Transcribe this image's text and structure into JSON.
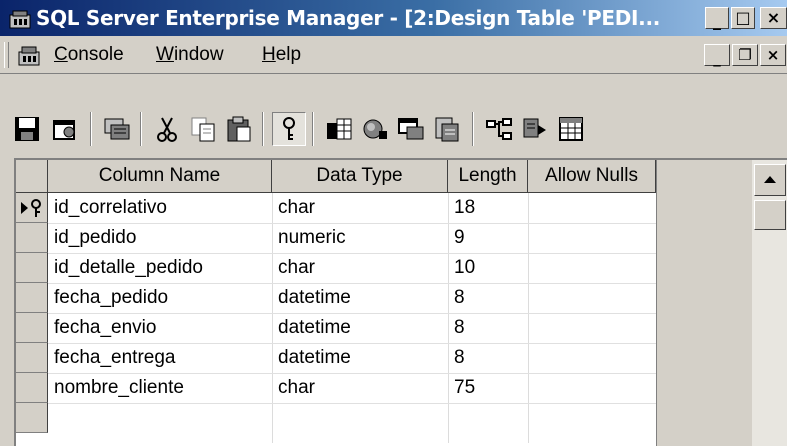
{
  "window": {
    "title": "SQL Server Enterprise Manager - [2:Design Table 'PEDI...",
    "minimize_label": "_",
    "maximize_label": "□",
    "close_label": "×"
  },
  "menu": {
    "items": [
      "Console",
      "Window",
      "Help"
    ],
    "mdi_minimize": "_",
    "mdi_restore": "❐",
    "mdi_close": "×"
  },
  "toolbar": {
    "buttons": [
      {
        "icon": "save-icon"
      },
      {
        "icon": "properties-icon"
      },
      {
        "icon": "generate-script-icon"
      },
      {
        "icon": "cut-icon"
      },
      {
        "icon": "copy-icon"
      },
      {
        "icon": "paste-icon"
      },
      {
        "icon": "primary-key-icon",
        "pressed": true
      },
      {
        "icon": "table-properties-icon"
      },
      {
        "icon": "manage-indexes-icon"
      },
      {
        "icon": "manage-relationships-icon"
      },
      {
        "icon": "manage-constraints-icon"
      },
      {
        "icon": "manage-triggers-icon"
      },
      {
        "icon": "insert-column-icon"
      },
      {
        "icon": "grid-view-icon"
      }
    ]
  },
  "grid": {
    "headers": [
      "Column Name",
      "Data Type",
      "Length",
      "Allow Nulls"
    ],
    "rows": [
      {
        "name": "id_correlativo",
        "type": "char",
        "length": "18",
        "primary_key": true
      },
      {
        "name": "id_pedido",
        "type": "numeric",
        "length": "9"
      },
      {
        "name": "id_detalle_pedido",
        "type": "char",
        "length": "10"
      },
      {
        "name": "fecha_pedido",
        "type": "datetime",
        "length": "8"
      },
      {
        "name": "fecha_envio",
        "type": "datetime",
        "length": "8"
      },
      {
        "name": "fecha_entrega",
        "type": "datetime",
        "length": "8"
      },
      {
        "name": "nombre_cliente",
        "type": "char",
        "length": "75"
      },
      {
        "name": "",
        "type": "",
        "length": ""
      }
    ]
  },
  "colors": {
    "title_gradient_start": "#0a246a",
    "title_gradient_end": "#a6caf0",
    "chrome": "#d4d0c8"
  }
}
